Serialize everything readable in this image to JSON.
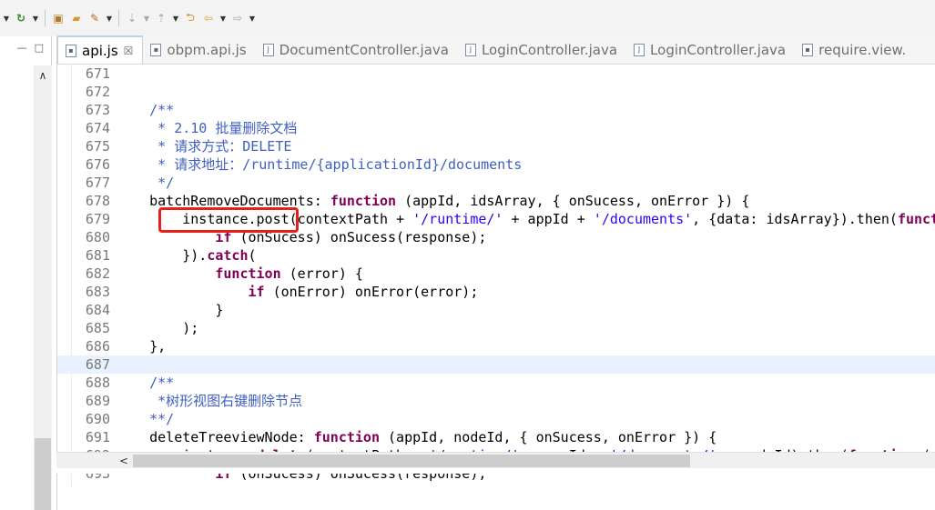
{
  "toolbar": {
    "icons": [
      "run-icon",
      "open-icon",
      "folder-icon",
      "wrench-icon",
      "annotation-icon",
      "annotation-next-icon",
      "back-icon",
      "forward-icon",
      "nav-next-icon"
    ]
  },
  "left_panel": {
    "minimize": "—",
    "maximize": "□"
  },
  "tabs": [
    {
      "label": "api.js",
      "active": true,
      "close": "☒"
    },
    {
      "label": "obpm.api.js",
      "active": false
    },
    {
      "label": "DocumentController.java",
      "active": false
    },
    {
      "label": "LoginController.java",
      "active": false
    },
    {
      "label": "LoginController.java",
      "active": false
    },
    {
      "label": "require.view.",
      "active": false
    }
  ],
  "code_lines": [
    {
      "n": "671",
      "parts": []
    },
    {
      "n": "672",
      "parts": []
    },
    {
      "n": "673",
      "parts": [
        {
          "t": "    /**",
          "c": "cm"
        }
      ]
    },
    {
      "n": "674",
      "parts": [
        {
          "t": "     * 2.10 批量删除文档",
          "c": "cm"
        }
      ]
    },
    {
      "n": "675",
      "parts": [
        {
          "t": "     * 请求方式：DELETE",
          "c": "cm"
        }
      ]
    },
    {
      "n": "676",
      "parts": [
        {
          "t": "     * 请求地址：/runtime/{applicationId}/documents",
          "c": "cm"
        }
      ]
    },
    {
      "n": "677",
      "parts": [
        {
          "t": "     */",
          "c": "cm"
        }
      ]
    },
    {
      "n": "678",
      "parts": [
        {
          "t": "    batchRemoveDocuments: ",
          "c": ""
        },
        {
          "t": "function",
          "c": "kw"
        },
        {
          "t": " (appId, idsArray, { onSucess, onError }) {",
          "c": ""
        }
      ]
    },
    {
      "n": "679",
      "parts": [
        {
          "t": "        instance.post(contextPath + ",
          "c": ""
        },
        {
          "t": "'/runtime/'",
          "c": "st"
        },
        {
          "t": " + appId + ",
          "c": ""
        },
        {
          "t": "'/documents'",
          "c": "st"
        },
        {
          "t": ", {data: idsArray}).then(",
          "c": ""
        },
        {
          "t": "function",
          "c": "kw"
        }
      ]
    },
    {
      "n": "680",
      "parts": [
        {
          "t": "            ",
          "c": ""
        },
        {
          "t": "if",
          "c": "kw"
        },
        {
          "t": " (onSucess) onSucess(response);",
          "c": ""
        }
      ]
    },
    {
      "n": "681",
      "parts": [
        {
          "t": "        }).",
          "c": ""
        },
        {
          "t": "catch",
          "c": "kw"
        },
        {
          "t": "(",
          "c": ""
        }
      ]
    },
    {
      "n": "682",
      "parts": [
        {
          "t": "            ",
          "c": ""
        },
        {
          "t": "function",
          "c": "kw"
        },
        {
          "t": " (error) {",
          "c": ""
        }
      ]
    },
    {
      "n": "683",
      "parts": [
        {
          "t": "                ",
          "c": ""
        },
        {
          "t": "if",
          "c": "kw"
        },
        {
          "t": " (onError) onError(error);",
          "c": ""
        }
      ]
    },
    {
      "n": "684",
      "parts": [
        {
          "t": "            }",
          "c": ""
        }
      ]
    },
    {
      "n": "685",
      "parts": [
        {
          "t": "        );",
          "c": ""
        }
      ]
    },
    {
      "n": "686",
      "parts": [
        {
          "t": "    },",
          "c": ""
        }
      ]
    },
    {
      "n": "687",
      "parts": [],
      "current": true
    },
    {
      "n": "688",
      "parts": [
        {
          "t": "    /**",
          "c": "cm"
        }
      ]
    },
    {
      "n": "689",
      "parts": [
        {
          "t": "     *树形视图右键删除节点",
          "c": "cm"
        }
      ]
    },
    {
      "n": "690",
      "parts": [
        {
          "t": "    **/",
          "c": "cm"
        }
      ]
    },
    {
      "n": "691",
      "parts": [
        {
          "t": "    deleteTreeviewNode: ",
          "c": ""
        },
        {
          "t": "function",
          "c": "kw"
        },
        {
          "t": " (appId, nodeId, { onSucess, onError }) {",
          "c": ""
        }
      ]
    },
    {
      "n": "692",
      "parts": [
        {
          "t": "        instance.",
          "c": ""
        },
        {
          "t": "delete",
          "c": "kw"
        },
        {
          "t": "(contextPath + ",
          "c": ""
        },
        {
          "t": "'/runtime/'",
          "c": "st"
        },
        {
          "t": " + appId + ",
          "c": ""
        },
        {
          "t": "'/documents/'",
          "c": "st"
        },
        {
          "t": " + nodeId).then(",
          "c": ""
        },
        {
          "t": "function",
          "c": "kw"
        },
        {
          "t": " (r",
          "c": ""
        }
      ]
    },
    {
      "n": "693",
      "parts": [
        {
          "t": "            ",
          "c": ""
        },
        {
          "t": "if",
          "c": "kw"
        },
        {
          "t": " (onSucess) onSucess(response);",
          "c": ""
        }
      ]
    }
  ],
  "colors": {
    "comment": "#3f5fbf",
    "keyword": "#7f0055",
    "string": "#2a00ff",
    "highlight_box": "#e8201c",
    "current_line": "#e8f2fe"
  }
}
